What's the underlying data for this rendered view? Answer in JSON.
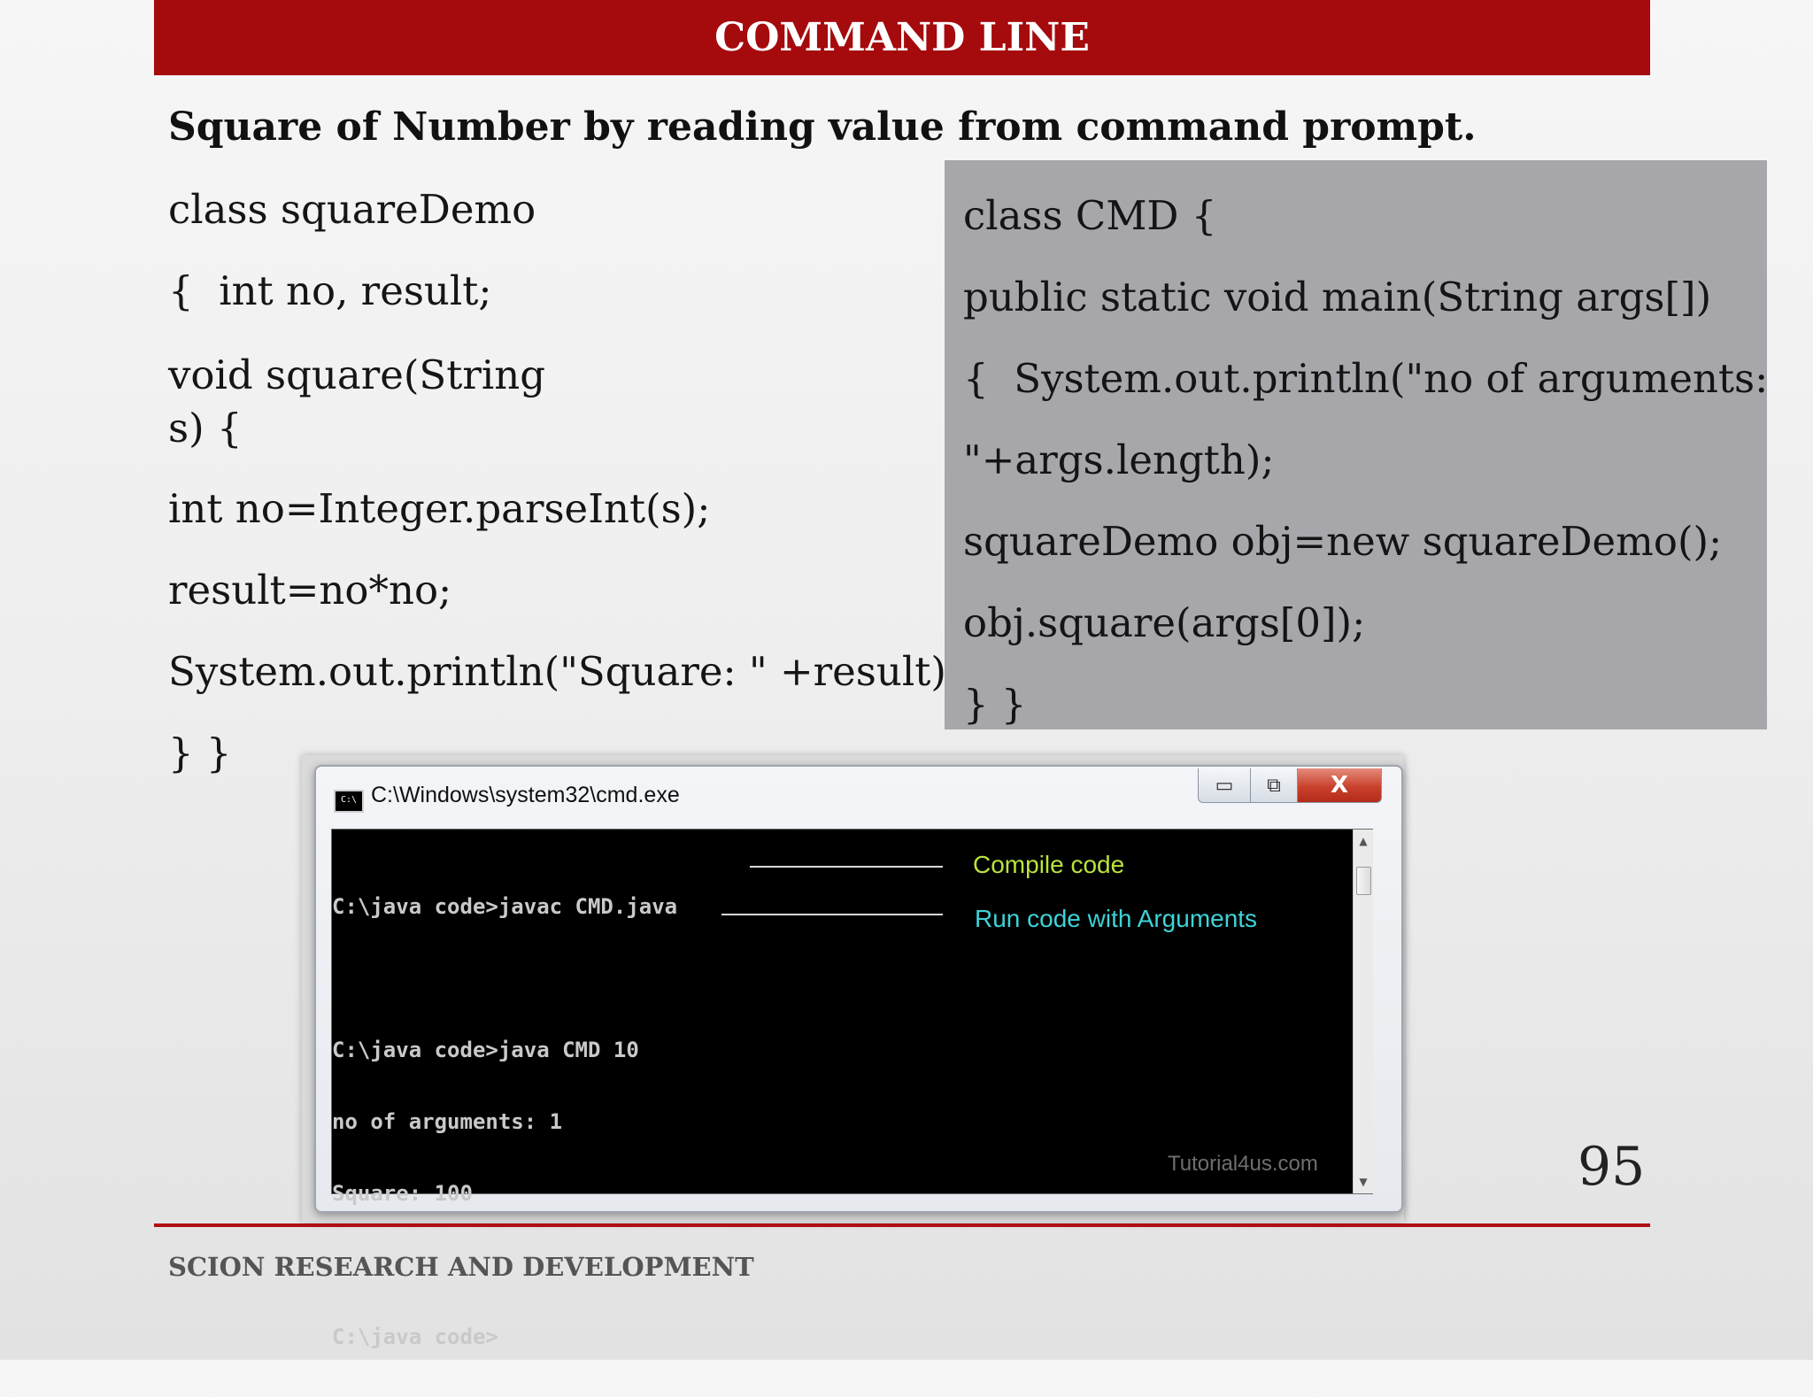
{
  "header": {
    "title": "COMMAND LINE"
  },
  "subtitle": "Square of Number by reading value from command prompt.",
  "left_code": {
    "line1": "class squareDemo",
    "line2": "{  int no, result;",
    "line3": "void square(String s) {",
    "line4": "int no=Integer.parseInt(s);",
    "line5": "result=no*no;",
    "line6": "System.out.println(\"Square: \" +result);",
    "line7": "} }"
  },
  "right_code": {
    "line1": "class CMD {",
    "line2": "public static void main(String args[])",
    "line3": "{  System.out.println(\"no of arguments:",
    "line4": "\"+args.length);",
    "line5": "squareDemo obj=new squareDemo();",
    "line6": "obj.square(args[0]);",
    "line7": "} }"
  },
  "cmd_window": {
    "title": "C:\\Windows\\system32\\cmd.exe",
    "icon_label": "C:\\",
    "buttons": {
      "minimize": "▭",
      "maximize": "⧉",
      "close": "X"
    },
    "console": {
      "line1": "C:\\java code>javac CMD.java",
      "line2": "",
      "line3": "C:\\java code>java CMD 10",
      "line4": "no of arguments: 1",
      "line5": "Square: 100",
      "line6": "",
      "line7": "C:\\java code>"
    },
    "annotations": {
      "compile": "Compile code",
      "run": "Run code with Arguments"
    },
    "watermark": "Tutorial4us.com"
  },
  "page_number": "95",
  "footer": {
    "text": "SCION RESEARCH AND DEVELOPMENT"
  },
  "colors": {
    "header_red": "#a50a0d",
    "code_box_gray": "#a7a6ab",
    "compile_note": "#b9e33d",
    "run_note": "#3ed3d7"
  }
}
